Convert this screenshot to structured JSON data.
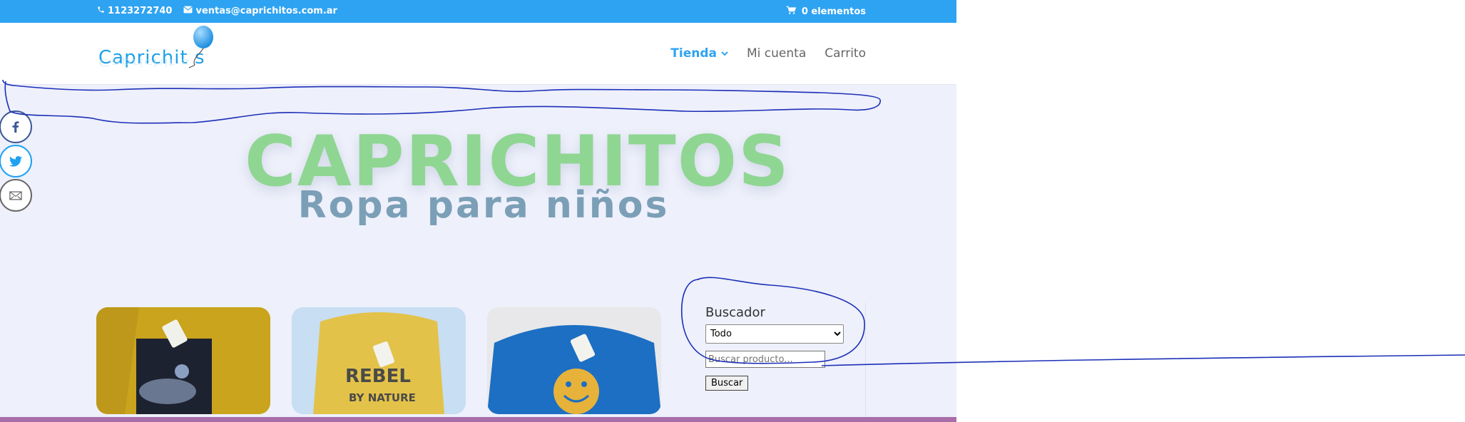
{
  "topbar": {
    "phone": "1123272740",
    "email": "ventas@caprichitos.com.ar",
    "cart": "0 elementos"
  },
  "header": {
    "logo_text": "Caprichit s",
    "nav": [
      {
        "label": "Tienda"
      },
      {
        "label": "Mi cuenta"
      },
      {
        "label": "Carrito"
      }
    ]
  },
  "hero": {
    "title": "CAPRICHITOS",
    "subtitle": "Ropa para niños"
  },
  "sidebar": {
    "title": "Buscador",
    "select_value": "Todo",
    "search_placeholder": "Buscar producto...",
    "search_button": "Buscar"
  },
  "colors": {
    "topbar": "#2ea3f2",
    "hero_title": "#8fd693",
    "hero_subtitle": "#7b9fb6",
    "annotation": "#1b2fb8",
    "bottom_bar": "#a96eaa"
  },
  "icons": {
    "phone": "phone-icon",
    "email": "envelope-icon",
    "cart": "cart-icon",
    "facebook": "facebook-icon",
    "twitter": "twitter-icon",
    "mail": "mail-icon"
  }
}
